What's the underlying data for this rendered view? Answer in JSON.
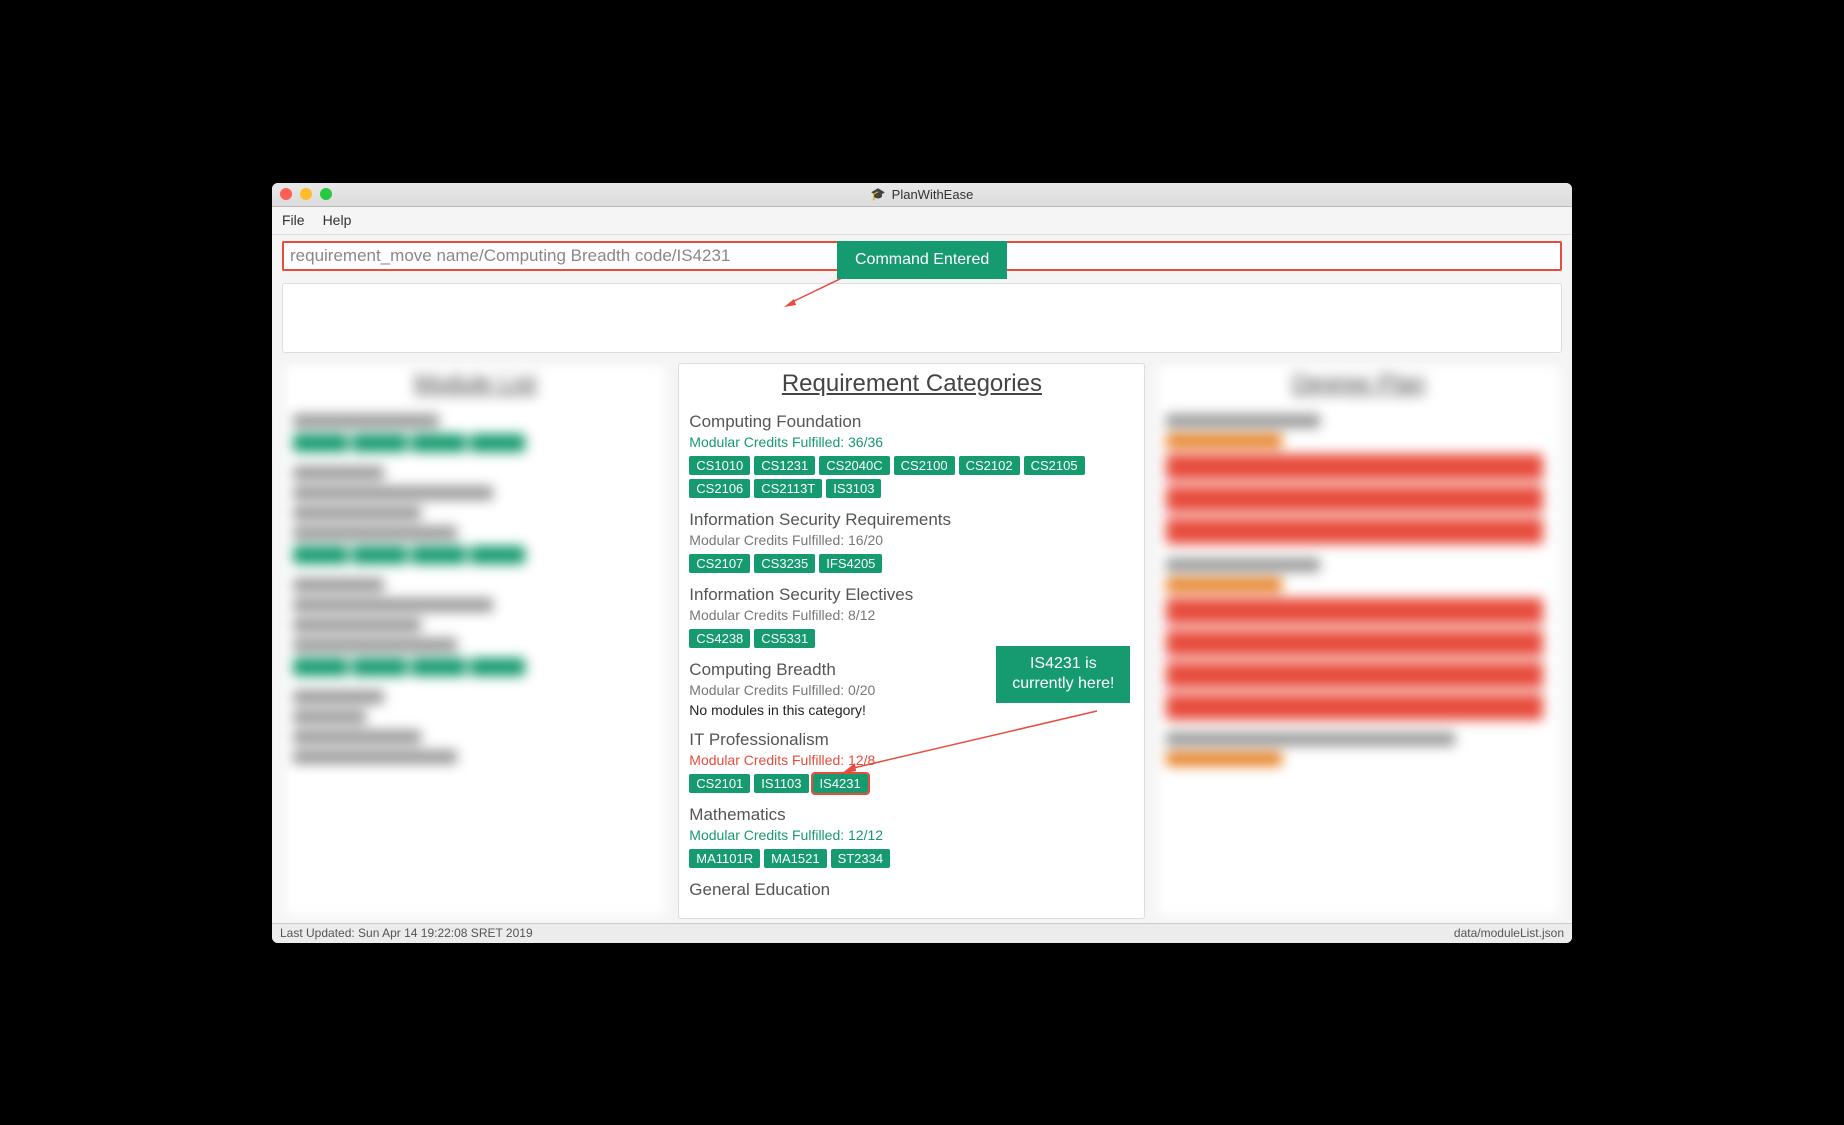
{
  "window": {
    "title": "PlanWithEase"
  },
  "menubar": {
    "file": "File",
    "help": "Help"
  },
  "command": {
    "value": "requirement_move name/Computing Breadth code/IS4231"
  },
  "callouts": {
    "command_entered": "Command Entered",
    "is4231_here": "IS4231 is\ncurrently here!"
  },
  "panels": {
    "left_title": "Module List",
    "mid_title": "Requirement Categories",
    "right_title": "Degree Plan"
  },
  "categories": [
    {
      "name": "Computing Foundation",
      "credits": "Modular Credits Fulfilled: 36/36",
      "credits_class": "credits-green",
      "modules": [
        "CS1010",
        "CS1231",
        "CS2040C",
        "CS2100",
        "CS2102",
        "CS2105",
        "CS2106",
        "CS2113T",
        "IS3103"
      ]
    },
    {
      "name": "Information Security Requirements",
      "credits": "Modular Credits Fulfilled: 16/20",
      "credits_class": "credits-grey",
      "modules": [
        "CS2107",
        "CS3235",
        "IFS4205"
      ]
    },
    {
      "name": "Information Security Electives",
      "credits": "Modular Credits Fulfilled: 8/12",
      "credits_class": "credits-grey",
      "modules": [
        "CS4238",
        "CS5331"
      ]
    },
    {
      "name": "Computing Breadth",
      "credits": "Modular Credits Fulfilled: 0/20",
      "credits_class": "credits-grey",
      "empty": "No modules in this category!",
      "modules": []
    },
    {
      "name": "IT Professionalism",
      "credits": "Modular Credits Fulfilled: 12/8",
      "credits_class": "credits-red",
      "modules": [
        "CS2101",
        "IS1103",
        "IS4231"
      ],
      "highlight": "IS4231"
    },
    {
      "name": "Mathematics",
      "credits": "Modular Credits Fulfilled: 12/12",
      "credits_class": "credits-green",
      "modules": [
        "MA1101R",
        "MA1521",
        "ST2334"
      ]
    },
    {
      "name": "General Education",
      "credits": "",
      "credits_class": "credits-grey",
      "modules": []
    }
  ],
  "status": {
    "left": "Last Updated: Sun Apr 14 19:22:08 SRET 2019",
    "right": "data/moduleList.json"
  }
}
